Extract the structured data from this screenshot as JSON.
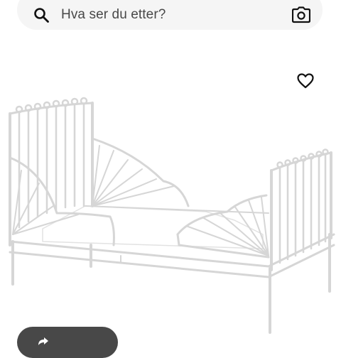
{
  "search": {
    "placeholder": "Hva ser du etter?",
    "search_icon": "search-icon",
    "camera_icon": "camera-icon"
  },
  "product": {
    "image_alt": "white metal extendable child bed",
    "favourite_icon": "heart-outline-icon"
  },
  "bottom_action": {
    "icon": "arrow-icon"
  },
  "colors": {
    "search_bg": "#f5f5f5",
    "text": "#484848",
    "pill_bg": "#484848",
    "icon": "#111111"
  }
}
